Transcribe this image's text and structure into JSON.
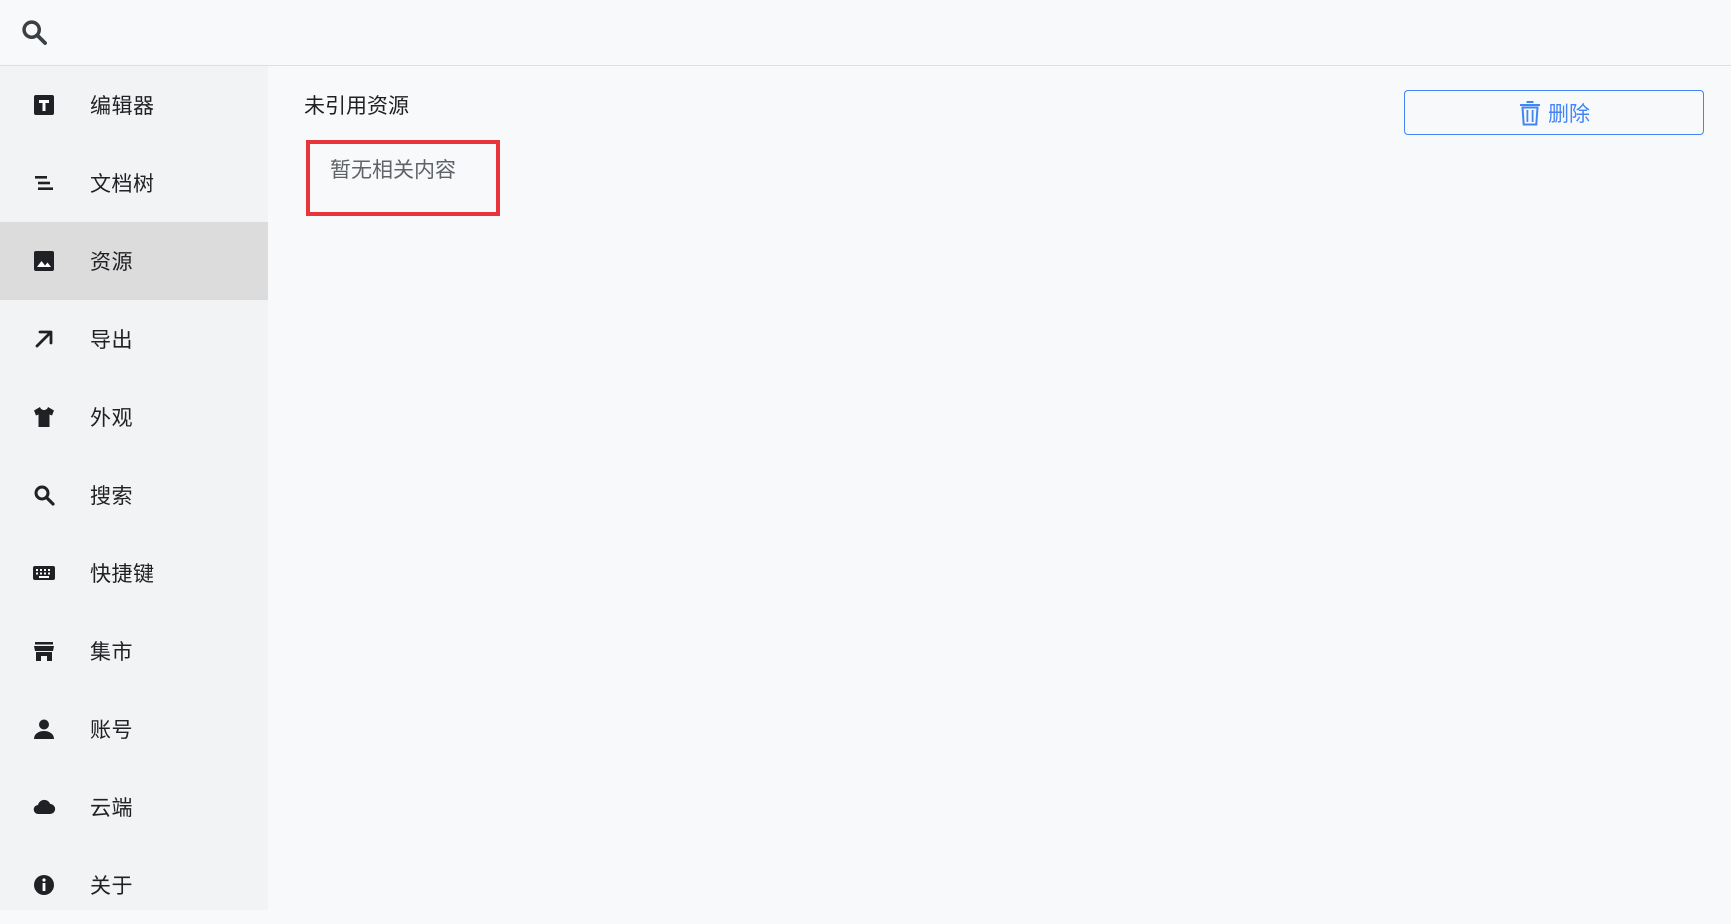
{
  "topbar": {
    "search_icon": "search-icon"
  },
  "sidebar": {
    "items": [
      {
        "label": "编辑器",
        "icon": "text-editor-icon",
        "active": false
      },
      {
        "label": "文档树",
        "icon": "doc-tree-icon",
        "active": false
      },
      {
        "label": "资源",
        "icon": "image-icon",
        "active": true
      },
      {
        "label": "导出",
        "icon": "export-arrow-icon",
        "active": false
      },
      {
        "label": "外观",
        "icon": "shirt-icon",
        "active": false
      },
      {
        "label": "搜索",
        "icon": "search-icon",
        "active": false
      },
      {
        "label": "快捷键",
        "icon": "keyboard-icon",
        "active": false
      },
      {
        "label": "集市",
        "icon": "store-icon",
        "active": false
      },
      {
        "label": "账号",
        "icon": "user-icon",
        "active": false
      },
      {
        "label": "云端",
        "icon": "cloud-icon",
        "active": false
      },
      {
        "label": "关于",
        "icon": "info-icon",
        "active": false
      }
    ]
  },
  "main": {
    "section_title": "未引用资源",
    "delete_label": "删除",
    "empty_text": "暂无相关内容"
  },
  "colors": {
    "accent": "#4285f4",
    "highlight": "#e8353b",
    "sidebar_bg": "#f2f3f4",
    "active_bg": "#dcdcdc"
  }
}
